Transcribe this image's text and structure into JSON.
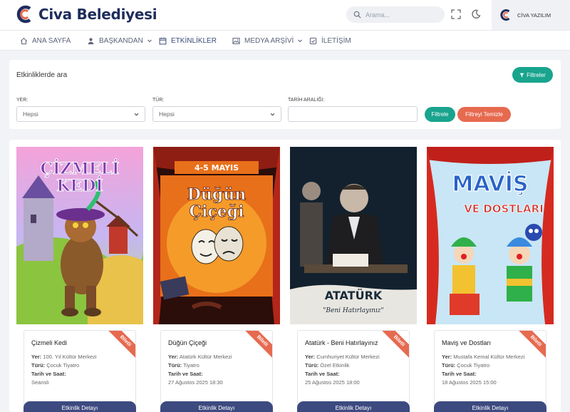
{
  "header": {
    "brand": "Civa Belediyesi",
    "search_placeholder": "Arama...",
    "user_name": "CİVA YAZILIM"
  },
  "nav": [
    {
      "label": "ANA SAYFA",
      "icon": "home-icon"
    },
    {
      "label": "BAŞKANDAN",
      "icon": "user-icon",
      "dropdown": true
    },
    {
      "label": "ETKİNLİKLER",
      "icon": "calendar-icon",
      "active": true
    },
    {
      "label": "MEDYA ARŞİVİ",
      "icon": "image-icon",
      "dropdown": true
    },
    {
      "label": "İLETİŞİM",
      "icon": "contact-icon"
    }
  ],
  "filters": {
    "title": "Etkinliklerde ara",
    "filters_button": "Filtreler",
    "yer_label": "YER:",
    "yer_value": "Hepsi",
    "tur_label": "TÜR:",
    "tur_value": "Hepsi",
    "date_label": "TARİH ARALIĞI:",
    "date_value": "",
    "apply_button": "Filtrele",
    "clear_button": "Filtreyi Temizle"
  },
  "events": [
    {
      "title": "Çizmeli Kedi",
      "venue_label": "Yer:",
      "venue": "100. Yıl Kültür Merkezi",
      "type_label": "Türü:",
      "type": "Çocuk Tiyatro",
      "date_label": "Tarih ve Saat:",
      "date": "Seanslı",
      "ribbon": "Biletli",
      "button": "Etkinlik Detayı",
      "poster_text": [
        "ÇİZMELİ",
        "KEDİ"
      ]
    },
    {
      "title": "Düğün Çiçeği",
      "venue_label": "Yer:",
      "venue": "Atatürk Kültür Merkezi",
      "type_label": "Türü:",
      "type": "Tiyatro",
      "date_label": "Tarih ve Saat:",
      "date": "27 Ağustos 2025 18:30",
      "ribbon": "Biletli",
      "button": "Etkinlik Detayı",
      "poster_text": [
        "4-5 MAYIS",
        "Düğün",
        "Çiçeği"
      ]
    },
    {
      "title": "Atatürk - Beni Hatırlayınız",
      "venue_label": "Yer:",
      "venue": "Cumhuriyet Kültür Merkezi",
      "type_label": "Türü:",
      "type": "Özel Etkinlik",
      "date_label": "Tarih ve Saat:",
      "date": "25 Ağustos 2025 18:00",
      "ribbon": "Biletli",
      "button": "Etkinlik Detayı",
      "poster_text": [
        "ATATÜRK",
        "\"Beni Hatırlayınız\""
      ]
    },
    {
      "title": "Maviş ve Dostları",
      "venue_label": "Yer:",
      "venue": "Mustafa Kemal Kültür Merkezi",
      "type_label": "Türü:",
      "type": "Çocuk Tiyatro",
      "date_label": "Tarih ve Saat:",
      "date": "18 Ağustos 2025 15:00",
      "ribbon": "Biletli",
      "button": "Etkinlik Detayı",
      "poster_text": [
        "MAVİŞ",
        "VE DOSTLARI"
      ]
    }
  ],
  "colors": {
    "brand": "#1f2d5c",
    "accent": "#19a48e",
    "danger": "#e66a4f",
    "button": "#3d4a80"
  }
}
